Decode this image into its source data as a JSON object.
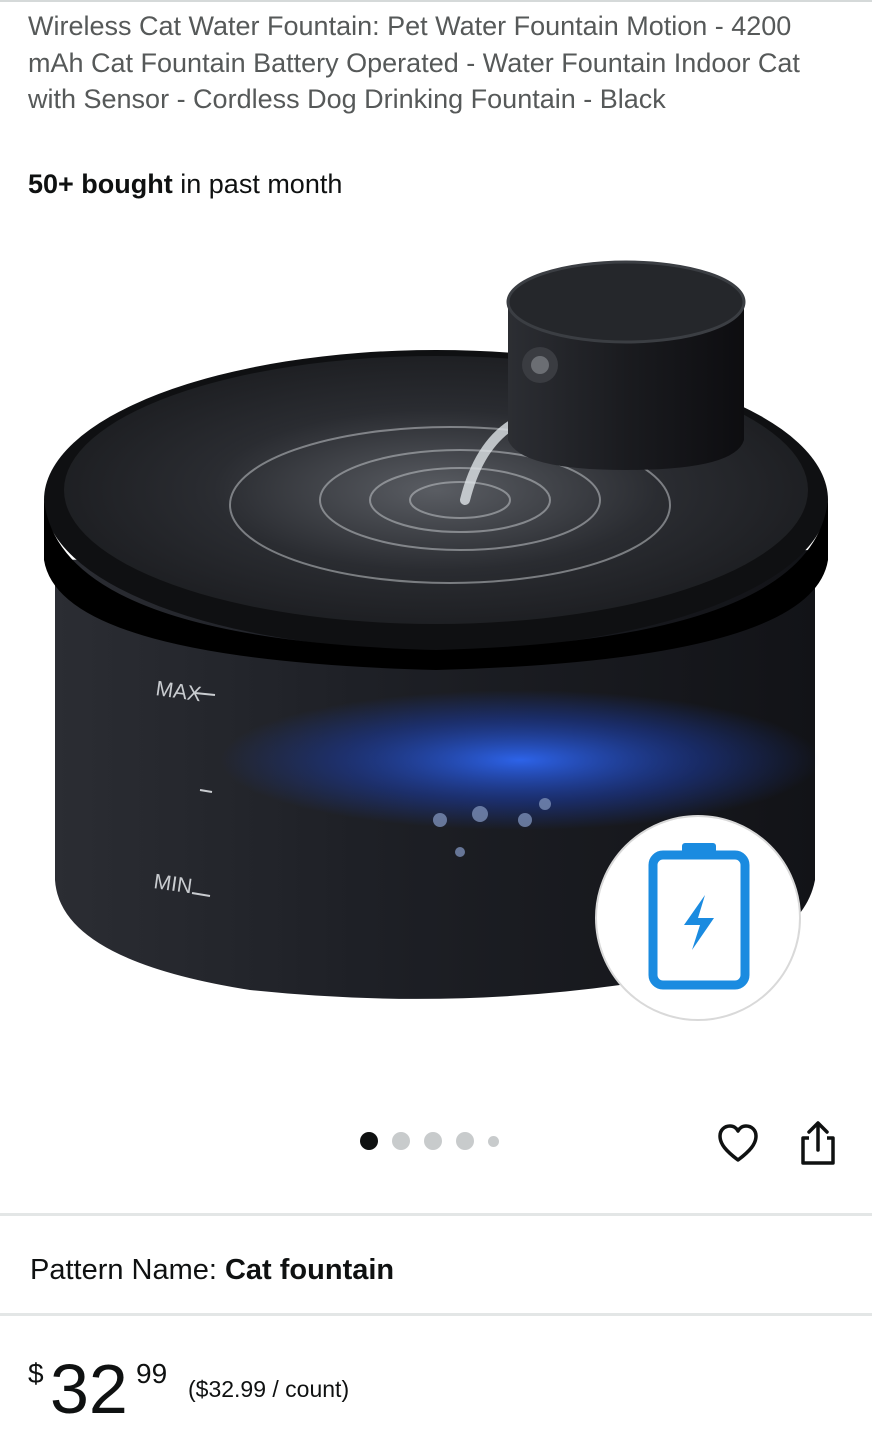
{
  "product": {
    "title": "Wireless Cat Water Fountain: Pet Water Fountain Motion - 4200 mAh Cat Fountain Battery Operated - Water Fountain Indoor Cat with Sensor - Cordless Dog Drinking Fountain - Black",
    "bought_bold": "50+ bought",
    "bought_rest": " in past month"
  },
  "image": {
    "max_label": "MAX",
    "min_label": "MIN",
    "badge_icon": "battery-bolt-icon",
    "carousel_count": 5,
    "carousel_active_index": 0
  },
  "actions": {
    "wishlist_icon": "heart-icon",
    "share_icon": "share-icon"
  },
  "variation": {
    "label": "Pattern Name:",
    "value": "Cat fountain"
  },
  "price": {
    "symbol": "$",
    "whole": "32",
    "fraction": "99",
    "per_unit": "($32.99 / count)"
  },
  "colors": {
    "accent_blue": "#1a8be0",
    "fountain_body": "#1c1e22"
  }
}
